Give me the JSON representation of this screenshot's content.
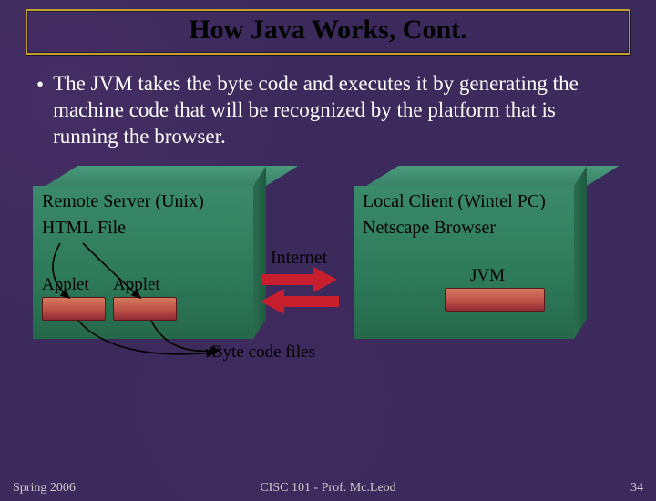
{
  "title": "How Java Works, Cont.",
  "bullet": "The JVM takes the byte code and executes it by generating the machine code that will be recognized by the platform that is running the browser.",
  "diagram": {
    "left_box": {
      "title": "Remote Server (Unix)",
      "sub": "HTML File",
      "applets": [
        "Applet",
        "Applet"
      ]
    },
    "right_box": {
      "title": "Local Client (Wintel PC)",
      "sub": "Netscape Browser",
      "jvm": "JVM"
    },
    "internet_label": "Internet",
    "bytecode_label": "Byte code files"
  },
  "footer": {
    "left": "Spring 2006",
    "center": "CISC 101 - Prof. Mc.Leod",
    "right": "34"
  }
}
